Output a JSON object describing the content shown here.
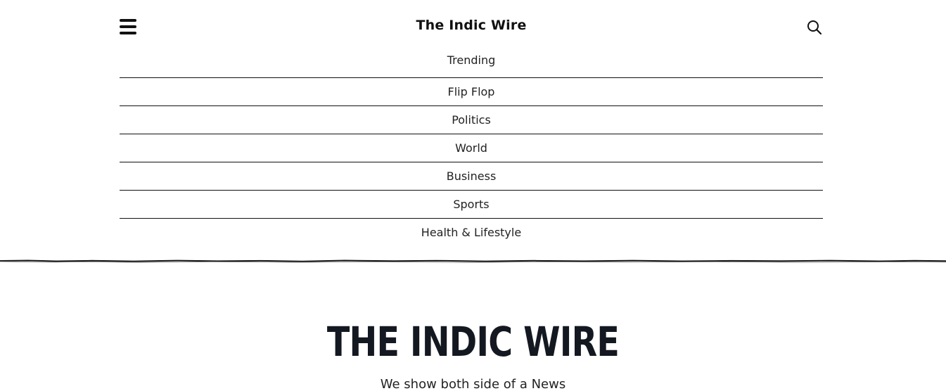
{
  "header": {
    "menu_icon": "hamburger-menu-icon",
    "title": "The Indic Wire",
    "search_icon": "search-icon"
  },
  "nav": {
    "items": [
      {
        "label": "Trending"
      },
      {
        "label": "Flip Flop"
      },
      {
        "label": "Politics"
      },
      {
        "label": "World"
      },
      {
        "label": "Business"
      },
      {
        "label": "Sports"
      },
      {
        "label": "Health & Lifestyle"
      }
    ]
  },
  "brand": {
    "logo_text": "THE INDIC WIRE",
    "tagline": "We show both side of a News"
  },
  "colors": {
    "text": "#111111",
    "logo": "#141820",
    "background": "#ffffff"
  }
}
